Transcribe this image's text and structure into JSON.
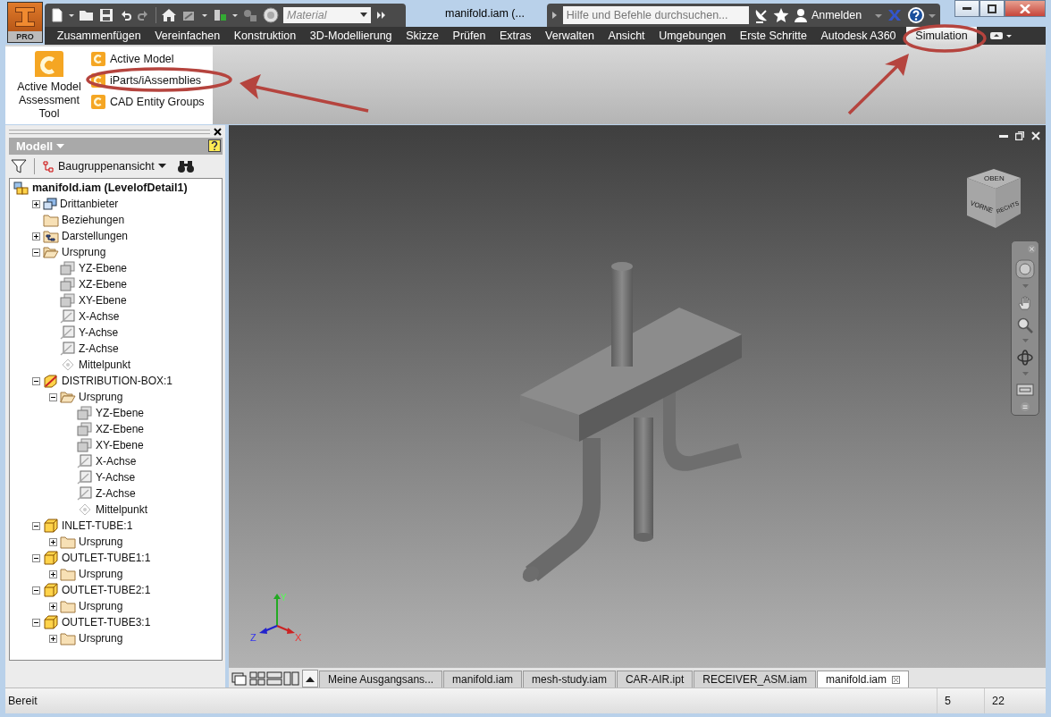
{
  "app_button": {
    "edition": "PRO"
  },
  "quick_access": {
    "material": "Material"
  },
  "window": {
    "title": "manifold.iam (..."
  },
  "search": {
    "placeholder": "Hilfe und Befehle durchsuchen..."
  },
  "account": {
    "label": "Anmelden"
  },
  "ribbon_tabs": [
    {
      "label": "Zusammenfügen",
      "selected": false
    },
    {
      "label": "Vereinfachen",
      "selected": false
    },
    {
      "label": "Konstruktion",
      "selected": false
    },
    {
      "label": "3D-Modellierung",
      "selected": false
    },
    {
      "label": "Skizze",
      "selected": false
    },
    {
      "label": "Prüfen",
      "selected": false
    },
    {
      "label": "Extras",
      "selected": false
    },
    {
      "label": "Verwalten",
      "selected": false
    },
    {
      "label": "Ansicht",
      "selected": false
    },
    {
      "label": "Umgebungen",
      "selected": false
    },
    {
      "label": "Erste Schritte",
      "selected": false
    },
    {
      "label": "Autodesk A360",
      "selected": false
    },
    {
      "label": "Simulation",
      "selected": true
    }
  ],
  "ribbon_panel": {
    "large_button": "Active Model Assessment Tool",
    "small_buttons": [
      "Active Model",
      "iParts/iAssemblies",
      "CAD Entity Groups"
    ]
  },
  "browser": {
    "title": "Modell",
    "view": "Baugruppenansicht",
    "tree": {
      "label": "manifold.iam (LevelofDetail1)",
      "kind": "assembly",
      "children": [
        {
          "label": "Drittanbieter",
          "kind": "thirdparty",
          "expanded": false
        },
        {
          "label": "Beziehungen",
          "kind": "folder"
        },
        {
          "label": "Darstellungen",
          "kind": "representations",
          "expanded": false
        },
        {
          "label": "Ursprung",
          "kind": "folder",
          "expanded": true,
          "children": [
            {
              "label": "YZ-Ebene",
              "kind": "plane"
            },
            {
              "label": "XZ-Ebene",
              "kind": "plane"
            },
            {
              "label": "XY-Ebene",
              "kind": "plane"
            },
            {
              "label": "X-Achse",
              "kind": "axis"
            },
            {
              "label": "Y-Achse",
              "kind": "axis"
            },
            {
              "label": "Z-Achse",
              "kind": "axis"
            },
            {
              "label": "Mittelpunkt",
              "kind": "point"
            }
          ]
        },
        {
          "label": "DISTRIBUTION-BOX:1",
          "kind": "component",
          "expanded": true,
          "children": [
            {
              "label": "Ursprung",
              "kind": "folder",
              "expanded": true,
              "children": [
                {
                  "label": "YZ-Ebene",
                  "kind": "plane"
                },
                {
                  "label": "XZ-Ebene",
                  "kind": "plane"
                },
                {
                  "label": "XY-Ebene",
                  "kind": "plane"
                },
                {
                  "label": "X-Achse",
                  "kind": "axis"
                },
                {
                  "label": "Y-Achse",
                  "kind": "axis"
                },
                {
                  "label": "Z-Achse",
                  "kind": "axis"
                },
                {
                  "label": "Mittelpunkt",
                  "kind": "point"
                }
              ]
            }
          ]
        },
        {
          "label": "INLET-TUBE:1",
          "kind": "part",
          "expanded": true,
          "children": [
            {
              "label": "Ursprung",
              "kind": "folder",
              "expanded": false
            }
          ]
        },
        {
          "label": "OUTLET-TUBE1:1",
          "kind": "part",
          "expanded": true,
          "children": [
            {
              "label": "Ursprung",
              "kind": "folder",
              "expanded": false
            }
          ]
        },
        {
          "label": "OUTLET-TUBE2:1",
          "kind": "part",
          "expanded": true,
          "children": [
            {
              "label": "Ursprung",
              "kind": "folder",
              "expanded": false
            }
          ]
        },
        {
          "label": "OUTLET-TUBE3:1",
          "kind": "part",
          "expanded": true,
          "children": [
            {
              "label": "Ursprung",
              "kind": "folder",
              "expanded": false
            }
          ]
        }
      ]
    }
  },
  "viewcube": {
    "faces": [
      "OBEN",
      "VORNE",
      "RECHTS"
    ]
  },
  "triad": {
    "axes": [
      "X",
      "Y",
      "Z"
    ]
  },
  "document_tabs": [
    {
      "label": "Meine Ausgangsans...",
      "selected": false
    },
    {
      "label": "manifold.iam",
      "selected": false
    },
    {
      "label": "mesh-study.iam",
      "selected": false
    },
    {
      "label": "CAR-AIR.ipt",
      "selected": false
    },
    {
      "label": "RECEIVER_ASM.iam",
      "selected": false
    },
    {
      "label": "manifold.iam",
      "selected": true
    }
  ],
  "status_bar": {
    "message": "Bereit",
    "cells": [
      "5",
      "22"
    ]
  }
}
